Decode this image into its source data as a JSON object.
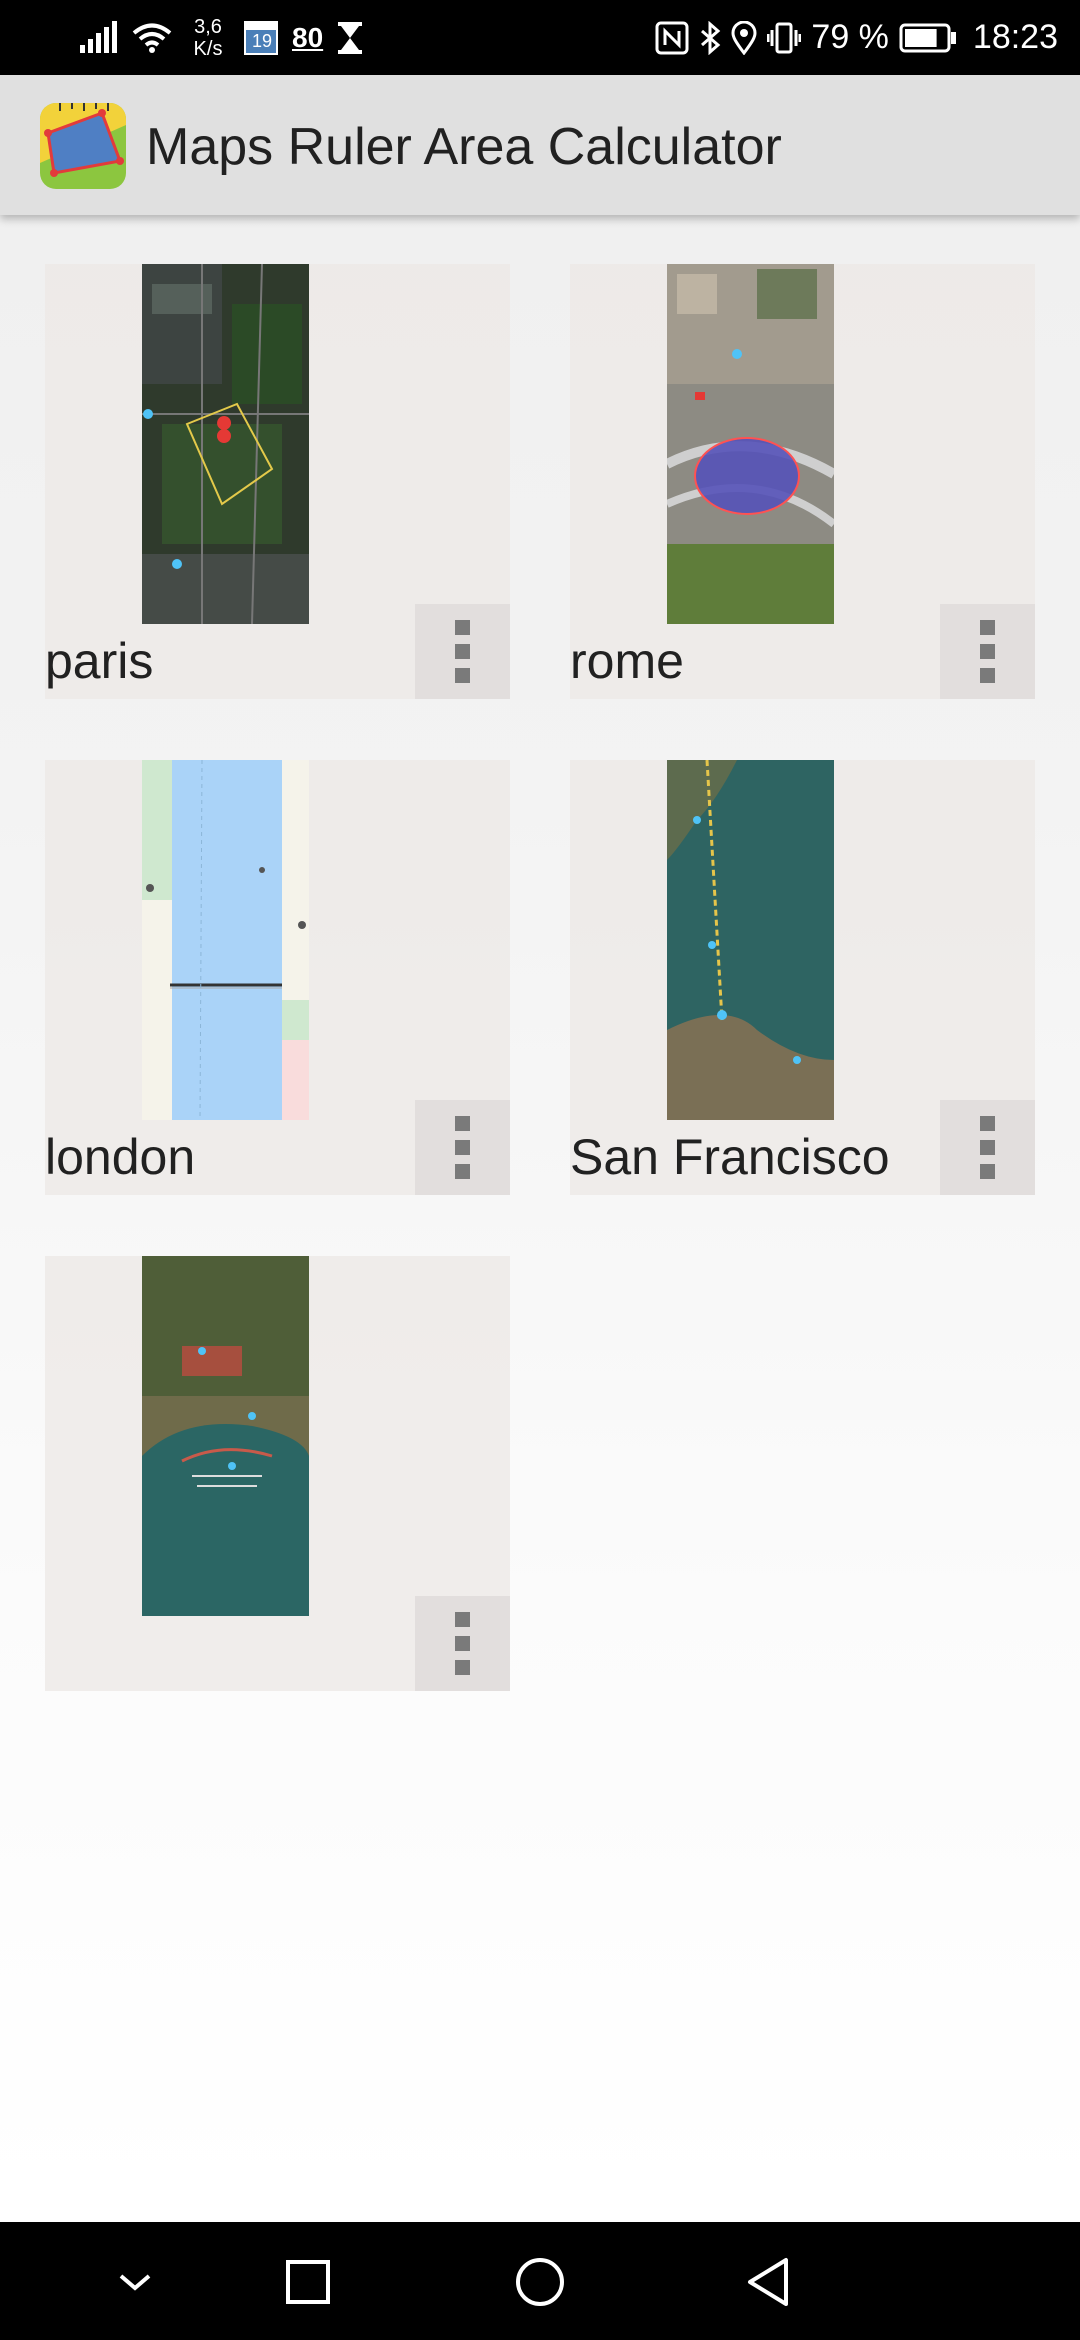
{
  "status_bar": {
    "net_speed": "3,6\nK/s",
    "calendar_day": "19",
    "notification_count": "80",
    "battery_percent": "79 %",
    "battery_level": 0.79,
    "time": "18:23",
    "icons": [
      "signal-icon",
      "wifi-icon",
      "calendar-icon",
      "hourglass-icon",
      "nfc-icon",
      "bluetooth-icon",
      "location-icon",
      "vibrate-icon",
      "battery-icon"
    ]
  },
  "app_bar": {
    "title": "Maps Ruler Area Calculator",
    "icon": "app-ruler-icon"
  },
  "saved_maps": [
    {
      "label": "paris",
      "thumbnail": "satellite-paris"
    },
    {
      "label": "rome",
      "thumbnail": "satellite-rome"
    },
    {
      "label": "london",
      "thumbnail": "map-london"
    },
    {
      "label": "San Francisco",
      "thumbnail": "satellite-san-francisco"
    },
    {
      "label": "",
      "thumbnail": "satellite-harbor"
    }
  ],
  "colors": {
    "status_bar": "#000000",
    "app_bar": "#e0e0e0",
    "card": "#ece8e6",
    "more_dots": "#7a7a7a",
    "text": "#212121"
  },
  "nav_bar": {
    "buttons": [
      "collapse-icon",
      "recents-icon",
      "home-icon",
      "back-icon"
    ]
  }
}
